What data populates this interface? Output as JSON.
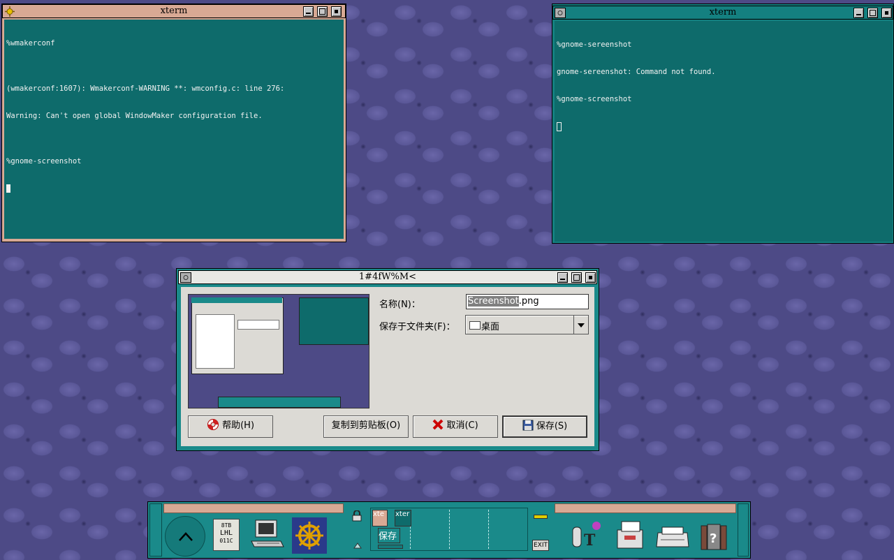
{
  "colors": {
    "terminal_bg": "#0e6b6b",
    "left_title_bg": "#d8a994",
    "right_title_bg": "#148080",
    "dialog_frame": "#1a8a8a",
    "desktop": "#4d4a86"
  },
  "left_term": {
    "title": "xterm",
    "lines": [
      "%wmakerconf",
      "",
      "(wmakerconf:1607): Wmakerconf-WARNING **: wmconfig.c: line 276:",
      "Warning: Can't open global WindowMaker configuration file.",
      "",
      "%gnome-screenshot"
    ]
  },
  "right_term": {
    "title": "xterm",
    "lines": [
      "%gnome-sereenshot",
      "gnome-sereenshot: Command not found.",
      "%gnome-screenshot"
    ]
  },
  "dialog": {
    "title": "1#4fW%M<",
    "name_label": "名称(N)：",
    "name_value_selected": "Screenshot",
    "name_value_rest": ".png",
    "folder_label": "保存于文件夹(F)：",
    "folder_value": "桌面",
    "buttons": {
      "help": "帮助(H)",
      "copy": "复制到剪贴板(O)",
      "cancel": "取消(C)",
      "save": "保存(S)"
    }
  },
  "dock": {
    "clip_labels": [
      "xte",
      "xter",
      "保存"
    ],
    "disk_label": [
      "8TB",
      "LHL",
      "011C"
    ],
    "exit_label": "EXIT"
  }
}
